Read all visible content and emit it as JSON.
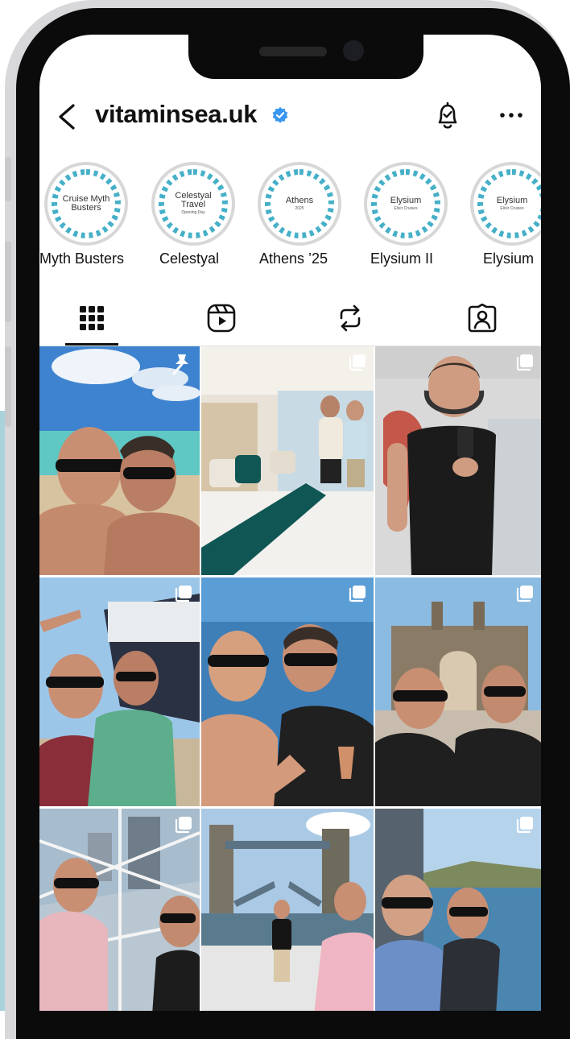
{
  "profile": {
    "username": "vitaminsea.uk",
    "verified": true
  },
  "header_icons": [
    "back-chevron-icon",
    "verified-badge-icon",
    "notification-bell-icon",
    "more-options-icon"
  ],
  "highlights": [
    {
      "cover_line1": "Cruise Myth",
      "cover_line2": "Busters",
      "cover_sub": "",
      "label": "Myth Busters"
    },
    {
      "cover_line1": "Celestyal",
      "cover_line2": "Travel",
      "cover_sub": "Opening Day",
      "label": "Celestyal"
    },
    {
      "cover_line1": "Athens",
      "cover_line2": "",
      "cover_sub": "2025",
      "label": "Athens ’25"
    },
    {
      "cover_line1": "Elysium",
      "cover_line2": "",
      "cover_sub": "Elixir Cruises",
      "label": "Elysium II"
    },
    {
      "cover_line1": "Elysium",
      "cover_line2": "",
      "cover_sub": "Elixir Cruises",
      "label": "Elysium"
    }
  ],
  "tabs": [
    {
      "icon": "grid-icon",
      "active": true
    },
    {
      "icon": "reels-icon",
      "active": false
    },
    {
      "icon": "reposts-icon",
      "active": false
    },
    {
      "icon": "tagged-icon",
      "active": false
    }
  ],
  "posts": [
    {
      "scene": "beach selfie",
      "badge": "pin-icon"
    },
    {
      "scene": "cruise cabin",
      "badge": "carousel-icon"
    },
    {
      "scene": "mirror selfie",
      "badge": "carousel-icon"
    },
    {
      "scene": "cruise ship selfie",
      "badge": "carousel-icon"
    },
    {
      "scene": "deck selfie with drink",
      "badge": "carousel-icon"
    },
    {
      "scene": "gateway of india",
      "badge": "carousel-icon"
    },
    {
      "scene": "observation dome",
      "badge": "carousel-icon"
    },
    {
      "scene": "tower bridge",
      "badge": "carousel-icon"
    },
    {
      "scene": "river cruise",
      "badge": "carousel-icon"
    }
  ],
  "colors": {
    "accent_ring": "#46b0c8",
    "verified_blue": "#3897f0",
    "text": "#111111",
    "bezel": "#0b0b0b"
  }
}
